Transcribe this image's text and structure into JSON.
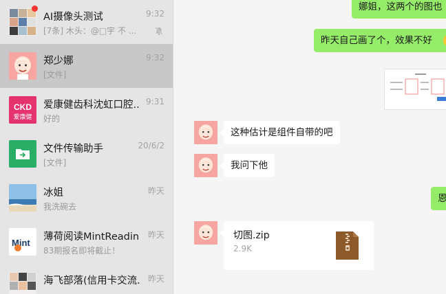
{
  "conversations": [
    {
      "title": "AI摄像头测试",
      "time": "9:32",
      "preview": "[7条] 木头：@□宇 不 ...",
      "muted": true,
      "unread_dot": true
    },
    {
      "title": "郑少娜",
      "time": "9:32",
      "preview": "[文件]",
      "active": true
    },
    {
      "title": "爱康健齿科沈虹口腔...",
      "time": "9:31",
      "preview": "好的",
      "avatar_text": "爱康健"
    },
    {
      "title": "文件传输助手",
      "time": "20/6/2",
      "preview": "[文件]"
    },
    {
      "title": "冰姐",
      "time": "昨天",
      "preview": "我洗碗去"
    },
    {
      "title": "薄荷阅读MintReading",
      "time": "昨天",
      "preview": "83期报名即将截止！",
      "avatar_text": "Mint"
    },
    {
      "title": "海飞部落(信用卡交流...",
      "time": "昨天",
      "preview": ""
    }
  ],
  "messages": {
    "m1": "娜姐，这两个的图也",
    "m2": "昨天自己画了个，效果不好",
    "m3": "这种估计是组件自带的吧",
    "m4": "我问下他",
    "m5": "恩",
    "file": {
      "name": "切图.zip",
      "size": "2.9K"
    }
  },
  "colors": {
    "sidebar_bg": "#e6e5e5",
    "active_bg": "#c9c8c8",
    "bubble_green": "#95ec69",
    "chat_bg": "#f5f5f5"
  }
}
